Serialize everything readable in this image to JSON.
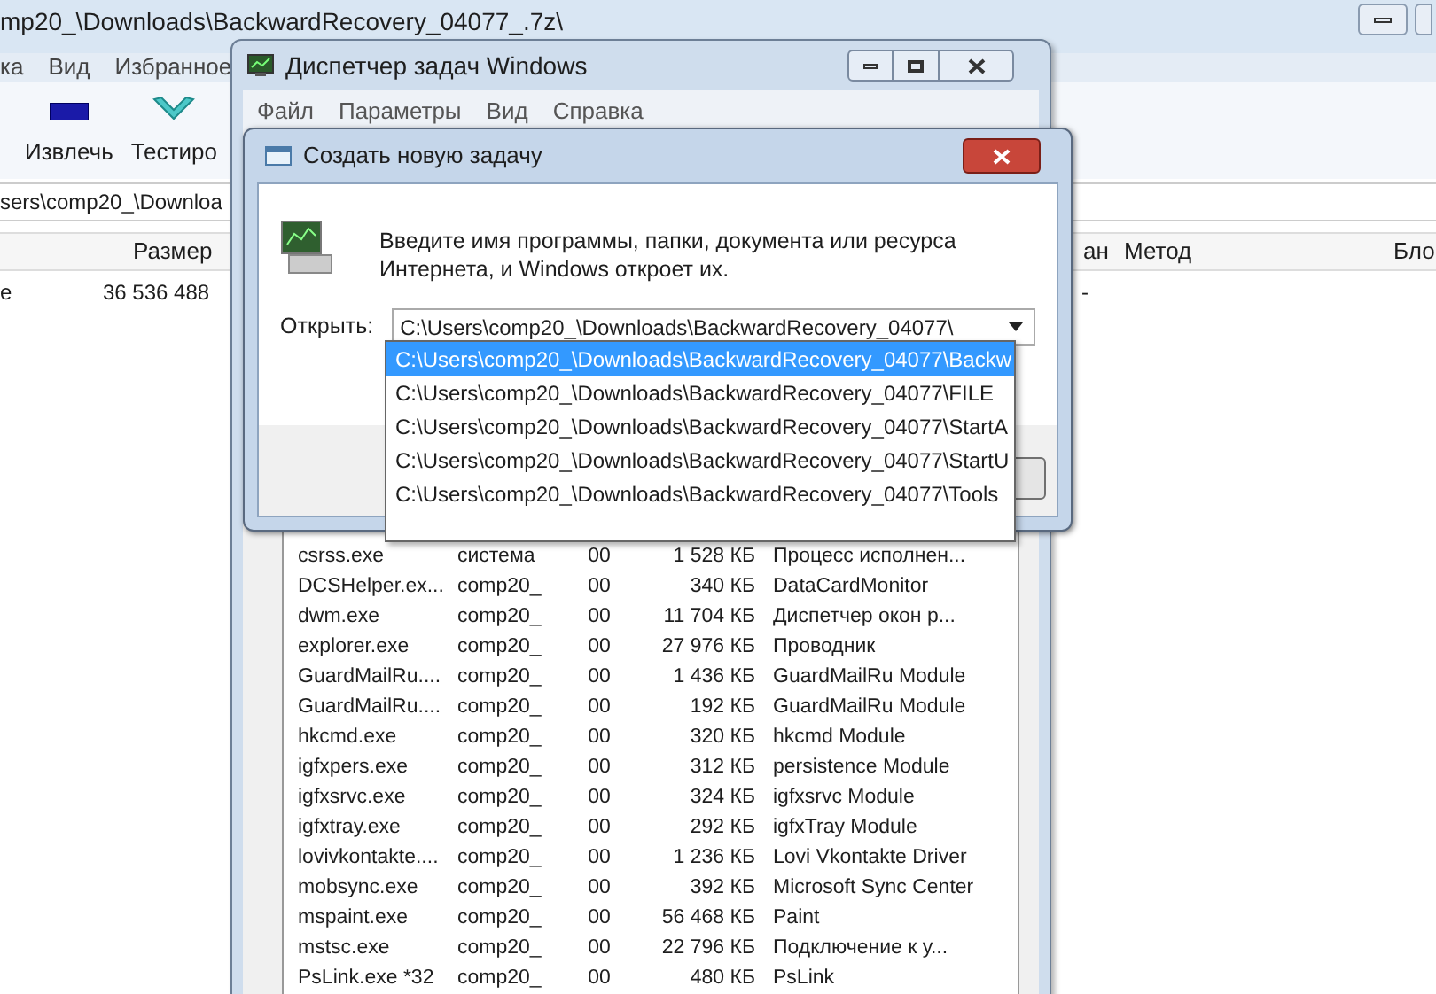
{
  "archive_window": {
    "title": "mp20_\\Downloads\\BackwardRecovery_04077_.7z\\",
    "menu": [
      "ка",
      "Вид",
      "Избранное"
    ],
    "toolbar": [
      {
        "label": "Извлечь",
        "kind": "extract"
      },
      {
        "label": "Тестиро",
        "kind": "test"
      }
    ],
    "address": "sers\\comp20_\\Downloa",
    "columns": [
      {
        "label": "Размер"
      },
      {
        "label": "ан"
      },
      {
        "label": "Метод"
      },
      {
        "label": "Бло"
      }
    ],
    "row": {
      "name": "е",
      "size": "36 536 488",
      "column_3": "-"
    }
  },
  "task_manager": {
    "title": "Диспетчер задач Windows",
    "menu": [
      "Файл",
      "Параметры",
      "Вид",
      "Справка"
    ],
    "processes": [
      {
        "name": "csrss.exe",
        "user": "система",
        "cpu": "00",
        "memory": "1 528 КБ",
        "description": "Процесс исполнен..."
      },
      {
        "name": "DCSHelper.ex...",
        "user": "comp20_",
        "cpu": "00",
        "memory": "340 КБ",
        "description": "DataCardMonitor"
      },
      {
        "name": "dwm.exe",
        "user": "comp20_",
        "cpu": "00",
        "memory": "11 704 КБ",
        "description": "Диспетчер окон р..."
      },
      {
        "name": "explorer.exe",
        "user": "comp20_",
        "cpu": "00",
        "memory": "27 976 КБ",
        "description": "Проводник"
      },
      {
        "name": "GuardMailRu....",
        "user": "comp20_",
        "cpu": "00",
        "memory": "1 436 КБ",
        "description": "GuardMailRu Module"
      },
      {
        "name": "GuardMailRu....",
        "user": "comp20_",
        "cpu": "00",
        "memory": "192 КБ",
        "description": "GuardMailRu Module"
      },
      {
        "name": "hkcmd.exe",
        "user": "comp20_",
        "cpu": "00",
        "memory": "320 КБ",
        "description": "hkcmd Module"
      },
      {
        "name": "igfxpers.exe",
        "user": "comp20_",
        "cpu": "00",
        "memory": "312 КБ",
        "description": "persistence Module"
      },
      {
        "name": "igfxsrvc.exe",
        "user": "comp20_",
        "cpu": "00",
        "memory": "324 КБ",
        "description": "igfxsrvc Module"
      },
      {
        "name": "igfxtray.exe",
        "user": "comp20_",
        "cpu": "00",
        "memory": "292 КБ",
        "description": "igfxTray Module"
      },
      {
        "name": "lovivkontakte....",
        "user": "comp20_",
        "cpu": "00",
        "memory": "1 236 КБ",
        "description": "Lovi Vkontakte Driver"
      },
      {
        "name": "mobsync.exe",
        "user": "comp20_",
        "cpu": "00",
        "memory": "392 КБ",
        "description": "Microsoft Sync Center"
      },
      {
        "name": "mspaint.exe",
        "user": "comp20_",
        "cpu": "00",
        "memory": "56 468 КБ",
        "description": "Paint"
      },
      {
        "name": "mstsc.exe",
        "user": "comp20_",
        "cpu": "00",
        "memory": "22 796 КБ",
        "description": "Подключение к у..."
      },
      {
        "name": "PsLink.exe *32",
        "user": "comp20_",
        "cpu": "00",
        "memory": "480 КБ",
        "description": "PsLink"
      }
    ]
  },
  "run_dialog": {
    "title": "Создать новую задачу",
    "prompt": "Введите имя программы, папки, документа или ресурса Интернета, и Windows откроет их.",
    "open_label": "Открыть:",
    "value": "C:\\Users\\comp20_\\Downloads\\BackwardRecovery_04077\\",
    "suggestions": [
      {
        "text": "C:\\Users\\comp20_\\Downloads\\BackwardRecovery_04077\\Backw",
        "selected": true
      },
      {
        "text": "C:\\Users\\comp20_\\Downloads\\BackwardRecovery_04077\\FILE",
        "selected": false
      },
      {
        "text": "C:\\Users\\comp20_\\Downloads\\BackwardRecovery_04077\\StartA",
        "selected": false
      },
      {
        "text": "C:\\Users\\comp20_\\Downloads\\BackwardRecovery_04077\\StartU",
        "selected": false
      },
      {
        "text": "C:\\Users\\comp20_\\Downloads\\BackwardRecovery_04077\\Tools",
        "selected": false
      }
    ]
  }
}
